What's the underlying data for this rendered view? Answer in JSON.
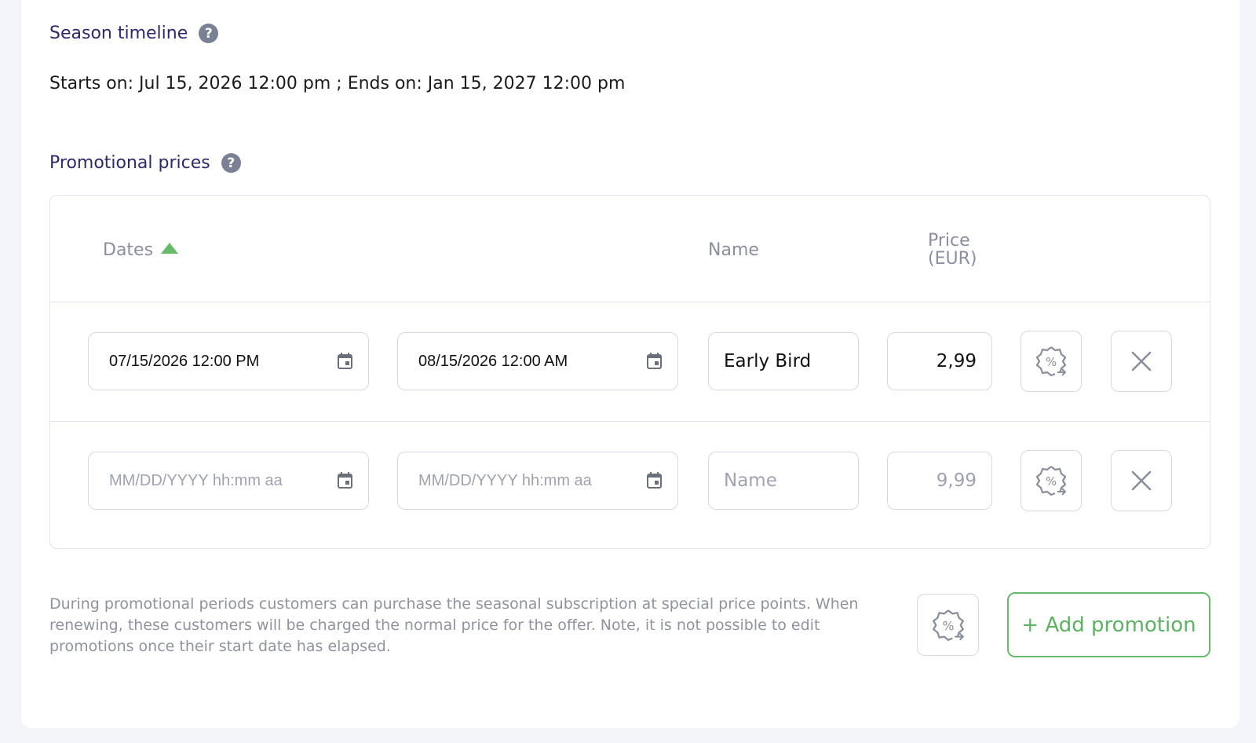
{
  "season": {
    "title": "Season timeline",
    "help": "?",
    "text": "Starts on: Jul 15, 2026 12:00 pm ; Ends on: Jan 15, 2027 12:00 pm"
  },
  "promotions": {
    "title": "Promotional prices",
    "help": "?",
    "columns": {
      "dates": "Dates",
      "name": "Name",
      "price": "Price\n(EUR)"
    },
    "rows": [
      {
        "start": "07/15/2026 12:00 PM",
        "end": "08/15/2026 12:00 AM",
        "name": "Early Bird",
        "price": "2,99"
      },
      {
        "start_placeholder": "MM/DD/YYYY hh:mm aa",
        "end_placeholder": "MM/DD/YYYY hh:mm aa",
        "name_placeholder": "Name",
        "price_placeholder": "9,99"
      }
    ],
    "note": "During promotional periods customers can purchase the seasonal subscription at special price points. When renewing, these customers will be charged the normal price for the offer. Note, it is not possible to edit promotions once their start date has elapsed.",
    "add_label": "+ Add promotion"
  },
  "colors": {
    "accent": "#66bb6a",
    "title": "#2b2a6b",
    "help": "#7a8195"
  },
  "icons": [
    "help-icon",
    "sort-ascending-icon",
    "calendar-icon",
    "discount-badge-icon",
    "close-icon"
  ]
}
